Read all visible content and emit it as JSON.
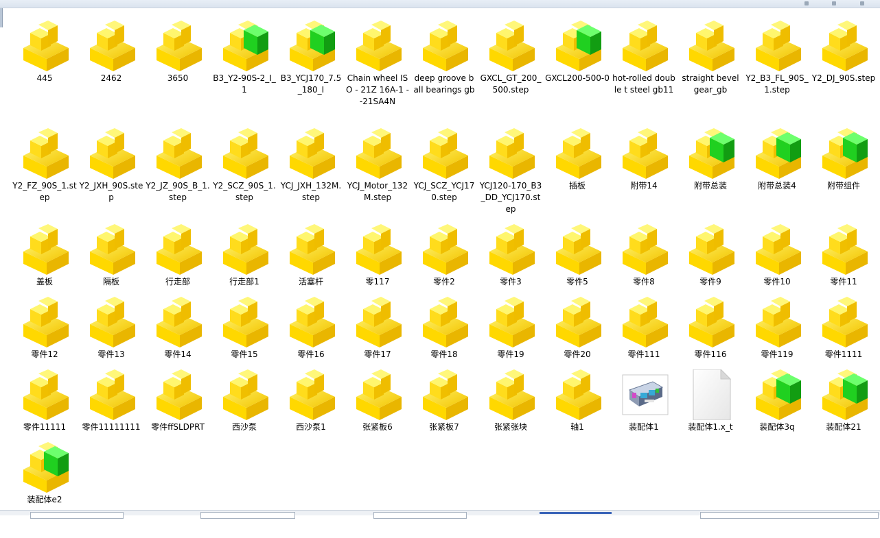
{
  "window": {
    "title": "",
    "accent": "#3a64b8"
  },
  "icons": {
    "part": "yellow-part-icon",
    "assembly": "yellow-green-assembly-icon",
    "drawing_thumb": "assembly-thumbnail-icon",
    "blank": "blank-file-icon"
  },
  "files": [
    {
      "name": "445",
      "icon": "part"
    },
    {
      "name": "2462",
      "icon": "part"
    },
    {
      "name": "3650",
      "icon": "part"
    },
    {
      "name": "B3_Y2-90S-2_I_1",
      "icon": "assembly"
    },
    {
      "name": "B3_YCJ170_7.5_180_I",
      "icon": "assembly"
    },
    {
      "name": "Chain wheel ISO - 21Z 16A-1 --21SA4N",
      "icon": "part"
    },
    {
      "name": "deep groove ball bearings gb",
      "icon": "part"
    },
    {
      "name": "GXCL_GT_200_500.step",
      "icon": "part"
    },
    {
      "name": "GXCL200-500-0",
      "icon": "assembly"
    },
    {
      "name": "hot-rolled double t steel gb11",
      "icon": "part"
    },
    {
      "name": "straight bevel gear_gb",
      "icon": "part"
    },
    {
      "name": "Y2_B3_FL_90S_1.step",
      "icon": "part"
    },
    {
      "name": "Y2_DJ_90S.step",
      "icon": "part"
    },
    {
      "name": "Y2_FZ_90S_1.step",
      "icon": "part"
    },
    {
      "name": "Y2_JXH_90S.step",
      "icon": "part"
    },
    {
      "name": "Y2_JZ_90S_B_1.step",
      "icon": "part"
    },
    {
      "name": "Y2_SCZ_90S_1.step",
      "icon": "part"
    },
    {
      "name": "YCJ_JXH_132M.step",
      "icon": "part"
    },
    {
      "name": "YCJ_Motor_132M.step",
      "icon": "part"
    },
    {
      "name": "YCJ_SCZ_YCJ170.step",
      "icon": "part"
    },
    {
      "name": "YCJ120-170_B3_DD_YCJ170.step",
      "icon": "part"
    },
    {
      "name": "插板",
      "icon": "part"
    },
    {
      "name": "附带14",
      "icon": "part"
    },
    {
      "name": "附带总装",
      "icon": "assembly"
    },
    {
      "name": "附带总装4",
      "icon": "assembly"
    },
    {
      "name": "附带组件",
      "icon": "assembly"
    },
    {
      "name": "盖板",
      "icon": "part"
    },
    {
      "name": "隔板",
      "icon": "part"
    },
    {
      "name": "行走部",
      "icon": "part"
    },
    {
      "name": "行走部1",
      "icon": "part"
    },
    {
      "name": "活塞杆",
      "icon": "part"
    },
    {
      "name": "零117",
      "icon": "part"
    },
    {
      "name": "零件2",
      "icon": "part"
    },
    {
      "name": "零件3",
      "icon": "part"
    },
    {
      "name": "零件5",
      "icon": "part"
    },
    {
      "name": "零件8",
      "icon": "part"
    },
    {
      "name": "零件9",
      "icon": "part"
    },
    {
      "name": "零件10",
      "icon": "part"
    },
    {
      "name": "零件11",
      "icon": "part"
    },
    {
      "name": "零件12",
      "icon": "part"
    },
    {
      "name": "零件13",
      "icon": "part"
    },
    {
      "name": "零件14",
      "icon": "part"
    },
    {
      "name": "零件15",
      "icon": "part"
    },
    {
      "name": "零件16",
      "icon": "part"
    },
    {
      "name": "零件17",
      "icon": "part"
    },
    {
      "name": "零件18",
      "icon": "part"
    },
    {
      "name": "零件19",
      "icon": "part"
    },
    {
      "name": "零件20",
      "icon": "part"
    },
    {
      "name": "零件111",
      "icon": "part"
    },
    {
      "name": "零件116",
      "icon": "part"
    },
    {
      "name": "零件119",
      "icon": "part"
    },
    {
      "name": "零件1111",
      "icon": "part"
    },
    {
      "name": "零件11111",
      "icon": "part"
    },
    {
      "name": "零件11111111",
      "icon": "part"
    },
    {
      "name": "零件ffSLDPRT",
      "icon": "part"
    },
    {
      "name": "西沙泵",
      "icon": "part"
    },
    {
      "name": "西沙泵1",
      "icon": "part"
    },
    {
      "name": "张紧板6",
      "icon": "part"
    },
    {
      "name": "张紧板7",
      "icon": "part"
    },
    {
      "name": "张紧张块",
      "icon": "part"
    },
    {
      "name": "轴1",
      "icon": "part"
    },
    {
      "name": "装配体1",
      "icon": "drawing_thumb"
    },
    {
      "name": "装配体1.x_t",
      "icon": "blank"
    },
    {
      "name": "装配体3q",
      "icon": "assembly"
    },
    {
      "name": "装配体21",
      "icon": "assembly"
    },
    {
      "name": "装配体e2",
      "icon": "assembly"
    }
  ]
}
